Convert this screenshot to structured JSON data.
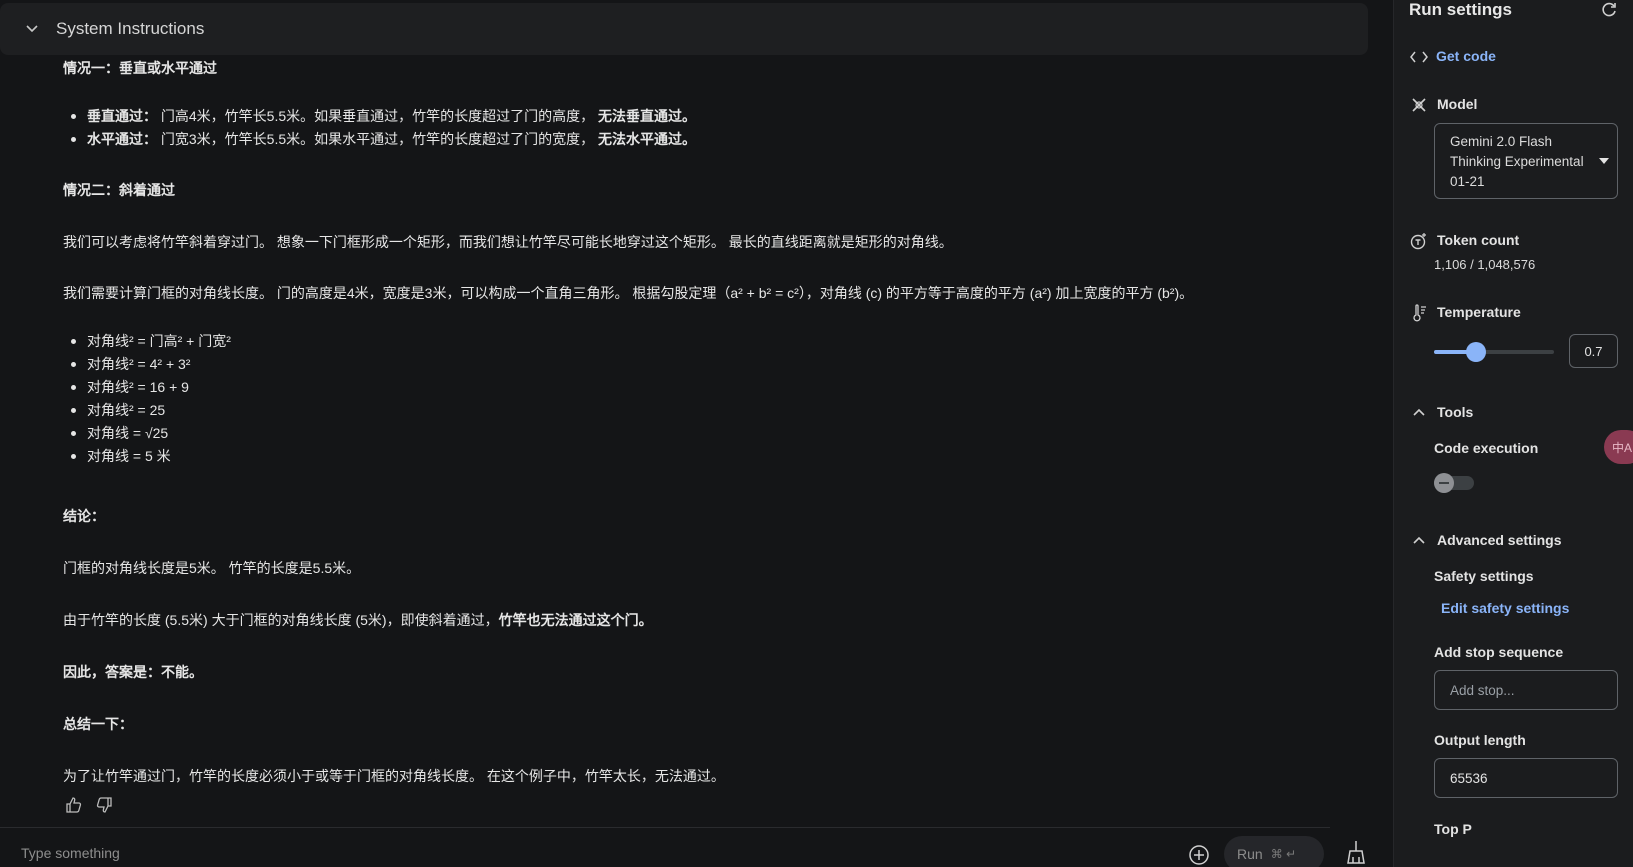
{
  "system_instructions": {
    "title": "System Instructions"
  },
  "content": {
    "case1_title": "情况一：垂直或水平通过",
    "case1_items": [
      {
        "bold_label": "垂直通过：",
        "text": " 门高4米，竹竿长5.5米。如果垂直通过，竹竿的长度超过了门的高度，",
        "bold_end": " 无法垂直通过。"
      },
      {
        "bold_label": "水平通过：",
        "text": " 门宽3米，竹竿长5.5米。如果水平通过，竹竿的长度超过了门的宽度，",
        "bold_end": " 无法水平通过。"
      }
    ],
    "case2_title": "情况二：斜着通过",
    "para1": "我们可以考虑将竹竿斜着穿过门。 想象一下门框形成一个矩形，而我们想让竹竿尽可能长地穿过这个矩形。 最长的直线距离就是矩形的对角线。",
    "para2": "我们需要计算门框的对角线长度。 门的高度是4米，宽度是3米，可以构成一个直角三角形。 根据勾股定理（a² + b² = c²），对角线 (c) 的平方等于高度的平方 (a²) 加上宽度的平方 (b²)。",
    "math_items": [
      "对角线² = 门高² + 门宽²",
      "对角线² = 4² + 3²",
      "对角线² = 16 + 9",
      "对角线² = 25",
      "对角线 = √25",
      "对角线 = 5 米"
    ],
    "conclusion_title": "结论：",
    "conclusion_text": "门框的对角线长度是5米。 竹竿的长度是5.5米。",
    "reason_text": "由于竹竿的长度 (5.5米) 大于门框的对角线长度 (5米)，即使斜着通过，",
    "reason_bold": "竹竿也无法通过这个门。",
    "answer": "因此，答案是：不能。",
    "summary_title": "总结一下：",
    "summary_text": "为了让竹竿通过门，竹竿的长度必须小于或等于门框的对角线长度。 在这个例子中，竹竿太长，无法通过。"
  },
  "input": {
    "placeholder": "Type something",
    "run_label": "Run",
    "shortcut": "⌘ ↵"
  },
  "run_settings": {
    "title": "Run settings",
    "get_code": "Get code",
    "model_label": "Model",
    "model_value": "Gemini 2.0 Flash Thinking Experimental 01-21",
    "token_label": "Token count",
    "token_value": "1,106 / 1,048,576",
    "temperature_label": "Temperature",
    "temperature_value": "0.7",
    "temperature_fraction": 0.35,
    "tools_label": "Tools",
    "code_execution_label": "Code execution",
    "code_execution_on": false,
    "advanced_label": "Advanced settings",
    "safety_label": "Safety settings",
    "edit_safety": "Edit safety settings",
    "stop_seq_label": "Add stop sequence",
    "stop_seq_placeholder": "Add stop...",
    "output_length_label": "Output length",
    "output_length_value": "65536",
    "top_p_label": "Top P"
  },
  "badge": {
    "text": "中A"
  },
  "colors": {
    "accent": "#8ab4f8",
    "background": "#141517",
    "panel": "#1b1c1e"
  }
}
